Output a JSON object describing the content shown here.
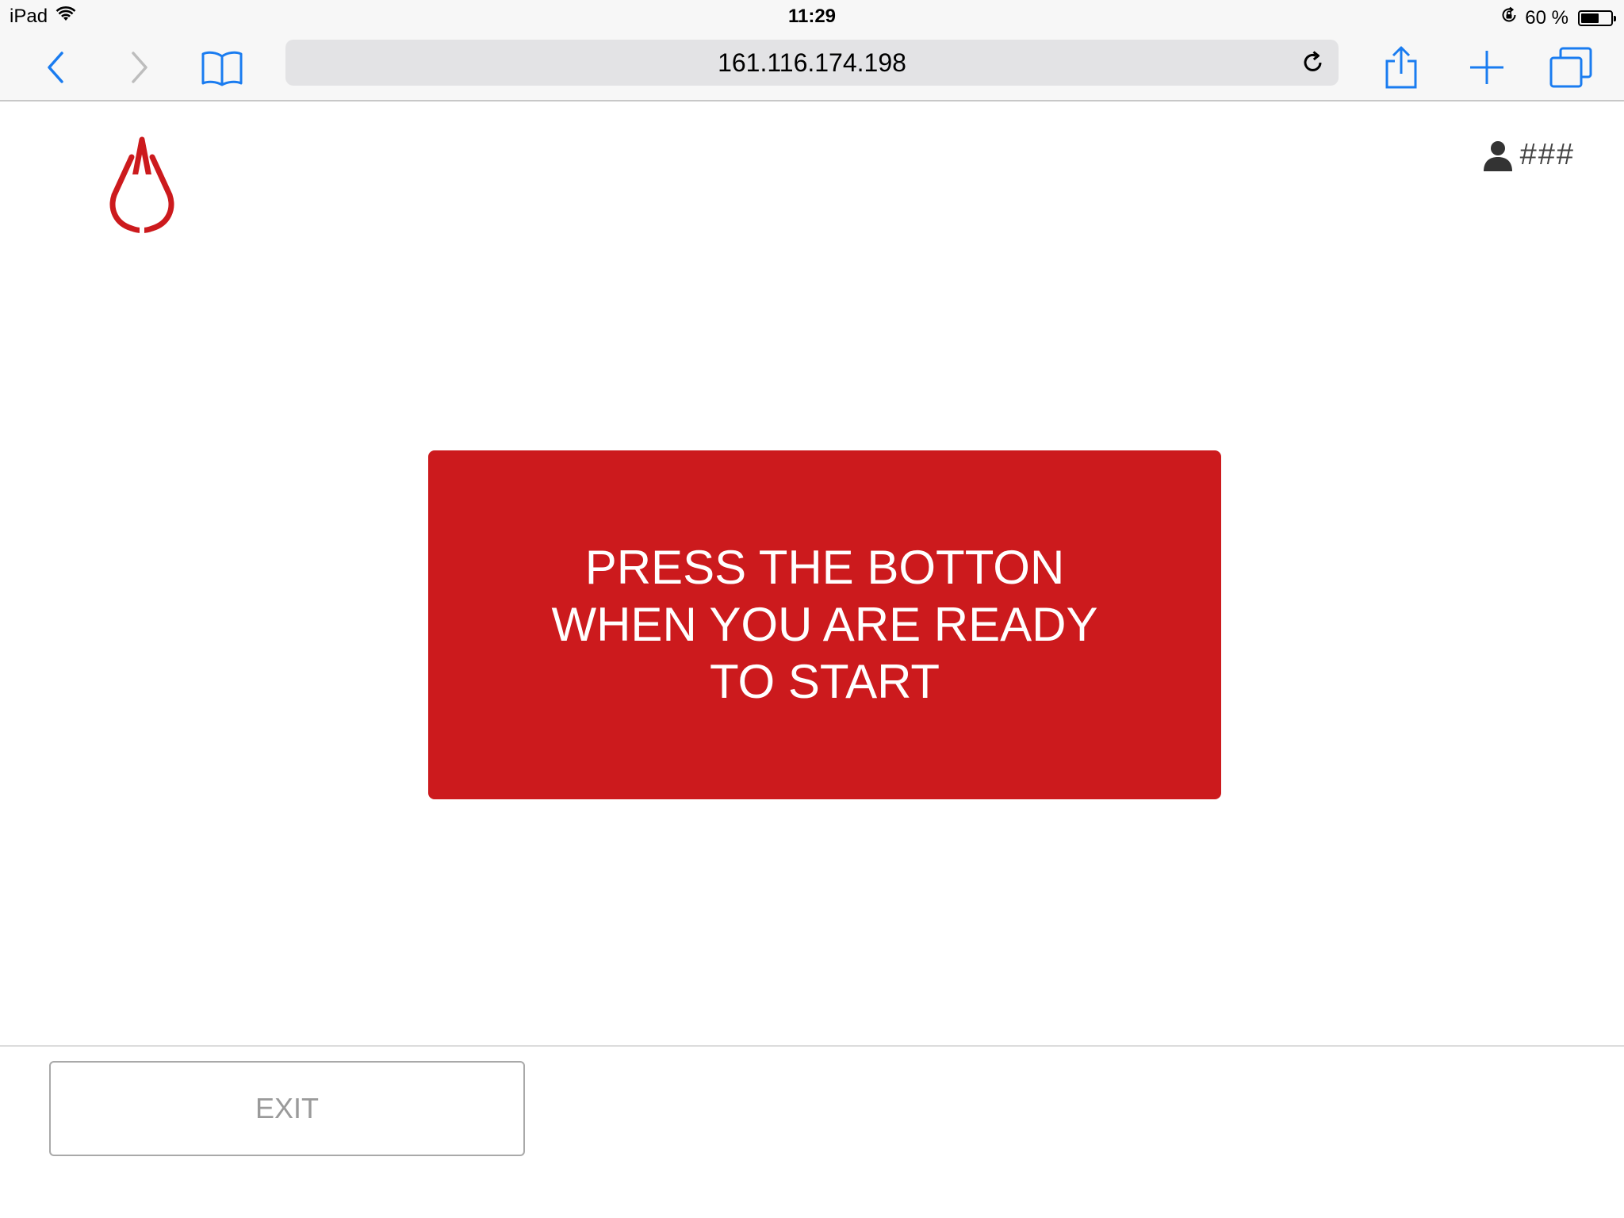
{
  "status_bar": {
    "device": "iPad",
    "time": "11:29",
    "battery_text": "60 %",
    "battery_level": 0.6
  },
  "browser": {
    "url": "161.116.174.198",
    "accent_color": "#1a7cf0"
  },
  "header": {
    "logo_icon": "blood-drop-icon",
    "user_icon": "user-icon",
    "user_name": "###"
  },
  "main": {
    "start_button_label": "PRESS THE BOTTON WHEN YOU ARE READY TO START",
    "start_button_color": "#cc1a1d"
  },
  "footer": {
    "exit_label": "EXIT"
  }
}
